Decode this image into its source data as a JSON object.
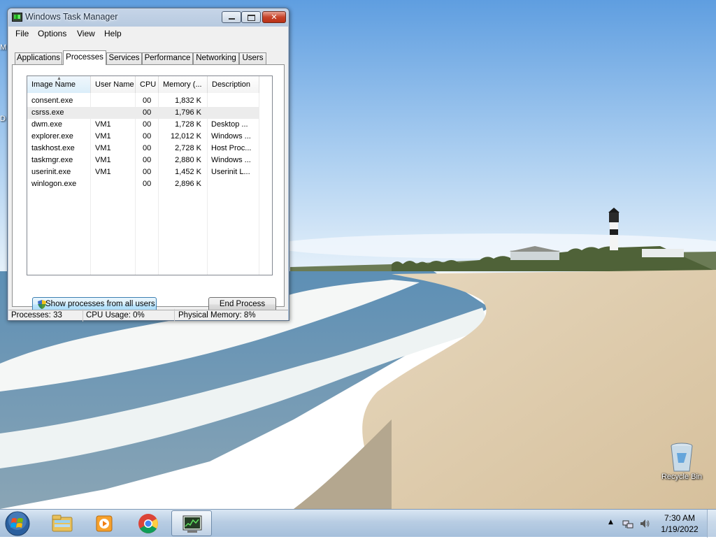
{
  "window": {
    "title": "Windows Task Manager",
    "close_glyph": "✕",
    "menu": [
      "File",
      "Options",
      "View",
      "Help"
    ],
    "tabs": [
      "Applications",
      "Processes",
      "Services",
      "Performance",
      "Networking",
      "Users"
    ],
    "active_tab": "Processes"
  },
  "processes": {
    "columns": [
      "Image Name",
      "User Name",
      "CPU",
      "Memory (...",
      "Description"
    ],
    "rows": [
      {
        "image": "consent.exe",
        "user": "",
        "cpu": "00",
        "memory": "1,832 K",
        "description": ""
      },
      {
        "image": "csrss.exe",
        "user": "",
        "cpu": "00",
        "memory": "1,796 K",
        "description": ""
      },
      {
        "image": "dwm.exe",
        "user": "VM1",
        "cpu": "00",
        "memory": "1,728 K",
        "description": "Desktop ..."
      },
      {
        "image": "explorer.exe",
        "user": "VM1",
        "cpu": "00",
        "memory": "12,012 K",
        "description": "Windows ..."
      },
      {
        "image": "taskhost.exe",
        "user": "VM1",
        "cpu": "00",
        "memory": "2,728 K",
        "description": "Host Proc..."
      },
      {
        "image": "taskmgr.exe",
        "user": "VM1",
        "cpu": "00",
        "memory": "2,880 K",
        "description": "Windows ..."
      },
      {
        "image": "userinit.exe",
        "user": "VM1",
        "cpu": "00",
        "memory": "1,452 K",
        "description": "Userinit L..."
      },
      {
        "image": "winlogon.exe",
        "user": "",
        "cpu": "00",
        "memory": "2,896 K",
        "description": ""
      }
    ],
    "selected_row": 1,
    "show_all_label": "Show processes from all users",
    "end_process_label": "End Process"
  },
  "status": {
    "processes": "Processes: 33",
    "cpu": "CPU Usage: 0%",
    "memory": "Physical Memory: 8%"
  },
  "desktop": {
    "recycle_bin_label": "Recycle Bin",
    "edge_letters": [
      "M",
      "D"
    ]
  },
  "taskbar": {
    "pinned": [
      "start-orb-icon",
      "windows-explorer-icon",
      "media-player-icon",
      "chrome-icon",
      "task-manager-icon"
    ],
    "time": "7:30 AM",
    "date": "1/19/2022"
  }
}
